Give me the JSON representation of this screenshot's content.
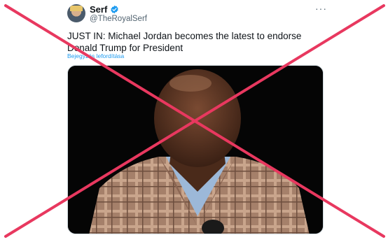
{
  "tweet": {
    "display_name": "Serf",
    "handle": "@TheRoyalSerf",
    "text": "JUST IN: Michael Jordan becomes the latest to endorse Donald Trump for President",
    "translate_label": "Bejegyzés lefordítása",
    "more_label": "···"
  },
  "colors": {
    "overlay_x": "#e8385f",
    "verified": "#1d9bf0",
    "link": "#1d9bf0"
  },
  "icons": {
    "verified": "verified-badge-icon",
    "more": "more-options-icon"
  }
}
